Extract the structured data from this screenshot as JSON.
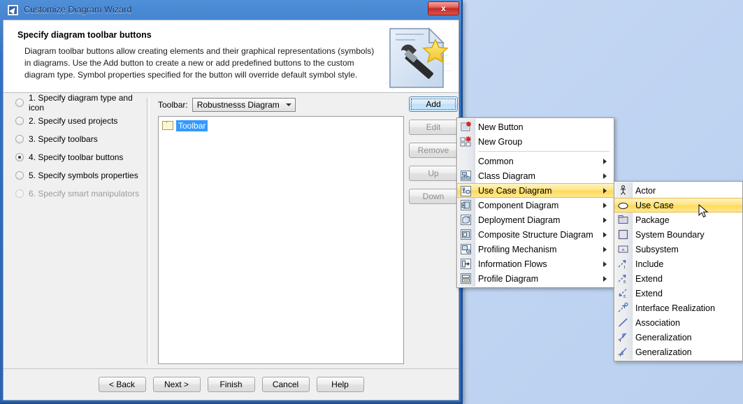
{
  "window": {
    "title": "Customize Diagram Wizard",
    "icon": "magicdraw-icon",
    "close_label": "x"
  },
  "header": {
    "title": "Specify diagram toolbar buttons",
    "description": "Diagram toolbar buttons allow creating elements and their graphical representations (symbols) in diagrams. Use the Add button to create a new or add predefined buttons to the custom diagram type. Symbol properties specified for the button will override default symbol style.",
    "art_icon": "document-hammer-star-icon"
  },
  "steps": [
    {
      "label": "1. Specify diagram type and icon",
      "selected": false,
      "disabled": false
    },
    {
      "label": "2. Specify used projects",
      "selected": false,
      "disabled": false
    },
    {
      "label": "3. Specify toolbars",
      "selected": false,
      "disabled": false
    },
    {
      "label": "4. Specify toolbar buttons",
      "selected": true,
      "disabled": false
    },
    {
      "label": "5. Specify symbols properties",
      "selected": false,
      "disabled": false
    },
    {
      "label": "6. Specify smart manipulators",
      "selected": false,
      "disabled": true
    }
  ],
  "panel": {
    "toolbar_label": "Toolbar:",
    "toolbar_value": "Robustnesss Diagram",
    "tree_item": "Toolbar",
    "side_buttons": [
      {
        "label": "Add",
        "enabled": true
      },
      {
        "label": "Edit",
        "enabled": false
      },
      {
        "label": "Remove",
        "enabled": false
      },
      {
        "label": "Up",
        "enabled": false
      },
      {
        "label": "Down",
        "enabled": false
      }
    ]
  },
  "footer": {
    "buttons": [
      "< Back",
      "Next >",
      "Finish",
      "Cancel",
      "Help"
    ]
  },
  "menu1": {
    "items": [
      {
        "label": "New Button",
        "icon": "new-button-icon",
        "submenu": false,
        "highlighted": false,
        "separator_after": false
      },
      {
        "label": "New Group",
        "icon": "new-group-icon",
        "submenu": false,
        "highlighted": false,
        "separator_after": true
      },
      {
        "label": "Common",
        "icon": "",
        "submenu": true,
        "highlighted": false,
        "separator_after": false
      },
      {
        "label": "Class Diagram",
        "icon": "class-diagram-icon",
        "submenu": true,
        "highlighted": false,
        "separator_after": false
      },
      {
        "label": "Use Case Diagram",
        "icon": "use-case-diagram-icon",
        "submenu": true,
        "highlighted": true,
        "separator_after": false
      },
      {
        "label": "Component Diagram",
        "icon": "component-diagram-icon",
        "submenu": true,
        "highlighted": false,
        "separator_after": false
      },
      {
        "label": "Deployment Diagram",
        "icon": "deployment-diagram-icon",
        "submenu": true,
        "highlighted": false,
        "separator_after": false
      },
      {
        "label": "Composite Structure Diagram",
        "icon": "composite-structure-diagram-icon",
        "submenu": true,
        "highlighted": false,
        "separator_after": false
      },
      {
        "label": "Profiling Mechanism",
        "icon": "profiling-mechanism-icon",
        "submenu": true,
        "highlighted": false,
        "separator_after": false
      },
      {
        "label": "Information Flows",
        "icon": "information-flows-icon",
        "submenu": true,
        "highlighted": false,
        "separator_after": false
      },
      {
        "label": "Profile Diagram",
        "icon": "profile-diagram-icon",
        "submenu": true,
        "highlighted": false,
        "separator_after": false
      }
    ]
  },
  "menu2": {
    "items": [
      {
        "label": "Actor",
        "icon": "actor-icon",
        "highlighted": false
      },
      {
        "label": "Use Case",
        "icon": "use-case-icon",
        "highlighted": true
      },
      {
        "label": "Package",
        "icon": "package-icon",
        "highlighted": false
      },
      {
        "label": "System Boundary",
        "icon": "system-boundary-icon",
        "highlighted": false
      },
      {
        "label": "Subsystem",
        "icon": "subsystem-icon",
        "highlighted": false
      },
      {
        "label": "Include",
        "icon": "include-arrow-icon",
        "highlighted": false
      },
      {
        "label": "Extend",
        "icon": "extend-arrow-icon",
        "highlighted": false
      },
      {
        "label": "Extend",
        "icon": "extend-reverse-arrow-icon",
        "highlighted": false
      },
      {
        "label": "Interface Realization",
        "icon": "interface-realization-icon",
        "highlighted": false
      },
      {
        "label": "Association",
        "icon": "association-line-icon",
        "highlighted": false
      },
      {
        "label": "Generalization",
        "icon": "generalization-arrow-icon",
        "highlighted": false
      },
      {
        "label": "Generalization",
        "icon": "generalization-reverse-arrow-icon",
        "highlighted": false
      }
    ]
  },
  "colors": {
    "titlebar": "#2d6ac4",
    "highlight": "#ffd957",
    "selection": "#3399ff",
    "desktop": "#c3d7f3"
  }
}
